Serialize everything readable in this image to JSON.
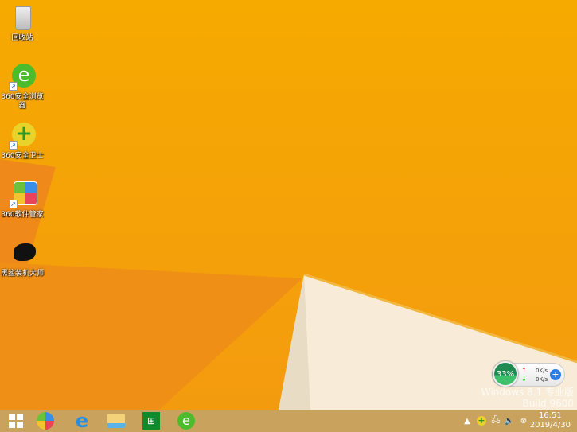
{
  "desktop": {
    "icons": [
      {
        "label": "回收站",
        "icon": "recycle-bin-icon"
      },
      {
        "label": "360安全浏览器",
        "icon": "360-browser-icon"
      },
      {
        "label": "360安全卫士",
        "icon": "360-security-icon"
      },
      {
        "label": "360软件管家",
        "icon": "360-software-manager-icon"
      },
      {
        "label": "黑鲨装机大师",
        "icon": "black-shark-icon"
      }
    ]
  },
  "watermark": {
    "line1": "Windows 8.1 专业版",
    "line2": "Build 9600"
  },
  "net_widget": {
    "percent": "33%",
    "upload": "0K/s",
    "download": "0K/s"
  },
  "taskbar": {
    "items": [
      "start",
      "360-software-manager",
      "internet-explorer",
      "file-explorer",
      "store",
      "360-browser"
    ]
  },
  "tray": {
    "time": "16:51",
    "date": "2019/4/30"
  },
  "colors": {
    "background": "#f5a500",
    "taskbar": "#c9a25e"
  }
}
